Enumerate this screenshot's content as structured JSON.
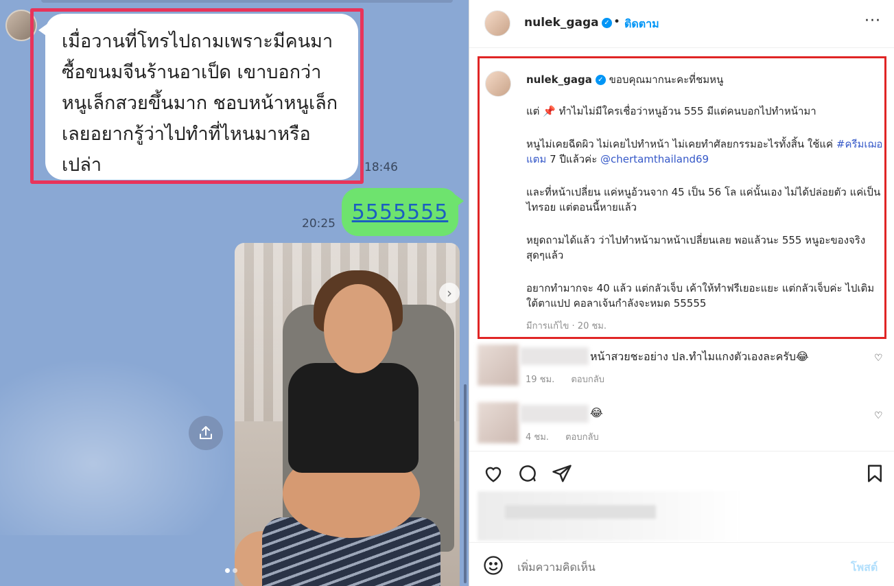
{
  "chat": {
    "incoming_message": "เมื่อวานที่โทรไปถามเพราะมีคนมาซื้อขนมจีนร้านอาเป็ด เขาบอกว่าหนูเล็กสวยขึ้นมาก ชอบหน้าหนูเล็ก เลยอยากรู้ว่าไปทำที่ไหนมาหรือเปล่า",
    "incoming_time": "18:46",
    "outgoing_message": "5555555",
    "outgoing_time": "20:25",
    "highlight_color": "#e8345a"
  },
  "instagram": {
    "username": "nulek_gaga",
    "follow_label": "ติดตาม",
    "dot": "•",
    "more_label": "···",
    "caption": {
      "username": "nulek_gaga",
      "line1": "ขอบคุณมากนะคะที่ชมหนู",
      "para1": "แต่ 📌 ทำไมไม่มีใครเชื่อว่าหนูอ้วน 555 มีแต่คนบอกไปทำหน้ามา",
      "para2_start": "หนูไม่เคยฉีดผิว ไม่เคยไปทำหน้า ไม่เคยทำศัลยกรรมอะไรทั้งสิ้น ใช้แค่ ",
      "hashtag": "#ครีมเฌอแตม",
      "para2_mid": " 7 ปีแล้วค่ะ ",
      "mention": "@chertamthailand69",
      "para3": "และที่หน้าเปลี่ยน แค่หนูอ้วนจาก 45 เป็น 56 โล แค่นั้นเอง ไม่ได้ปล่อยตัว แค่เป็นไทรอย แต่ตอนนี้หายแล้ว",
      "para4": "หยุดถามได้แล้ว ว่าไปทำหน้ามาหน้าเปลี่ยนเลย พอแล้วนะ 555 หนูอะของจริงสุดๆแล้ว",
      "para5": "อยากทำมากจะ 40 แล้ว แต่กลัวเจ็บ เค้าให้ทำฟรีเยอะแยะ แต่กลัวเจ็บค่ะ ไปเติมใต้ตาแปป คอลาเจ้นกำลังจะหมด 55555",
      "meta": "มีการแก้ไข · 20 ชม.",
      "highlight_color": "#e02525"
    },
    "comments": [
      {
        "text": "หน้าสวยชะอย่าง ปล.ทำไมแกงตัวเองละครับ😂",
        "time": "19 ชม.",
        "reply": "ตอบกลับ"
      },
      {
        "text": "😂",
        "time": "4 ชม.",
        "reply": "ตอบกลับ"
      }
    ],
    "add_comment_placeholder": "เพิ่มความคิดเห็น",
    "post_label": "โพสต์",
    "accent": "#0095f6"
  }
}
